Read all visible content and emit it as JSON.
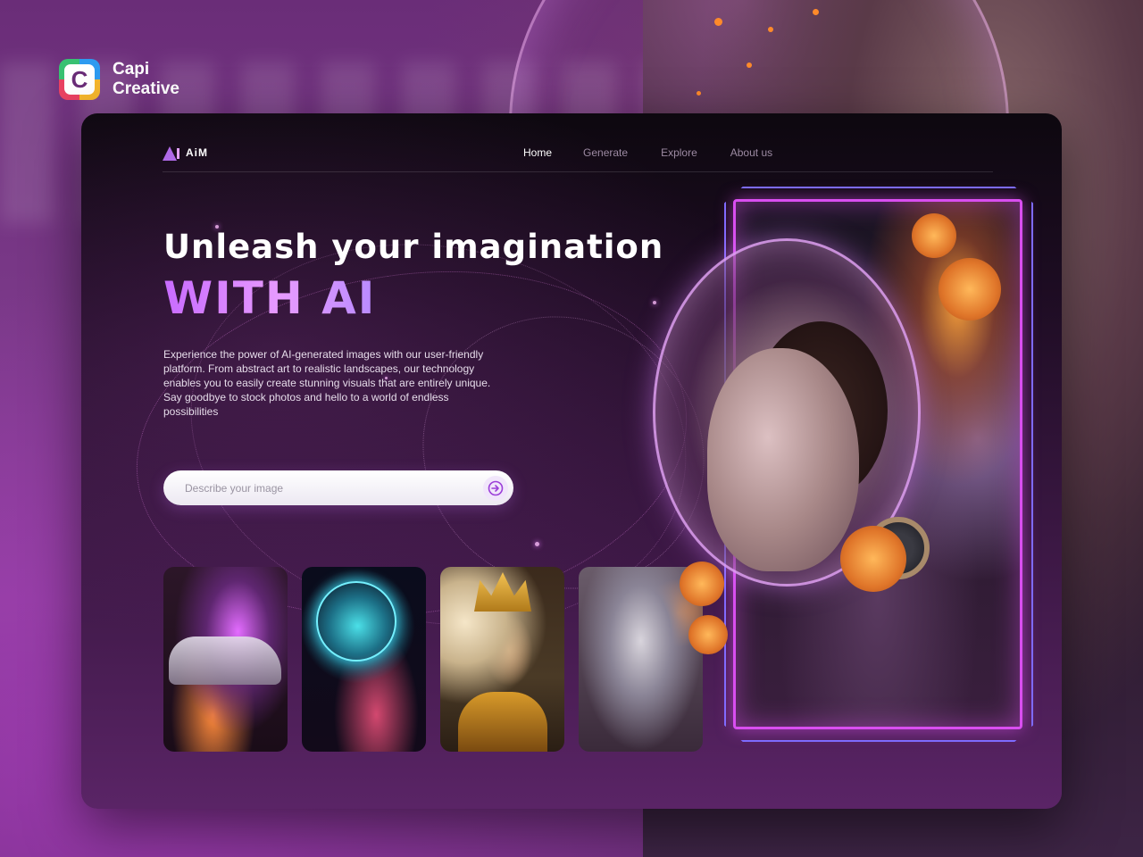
{
  "brand": {
    "name_line1": "Capi",
    "name_line2": "Creative",
    "logo_icon": "capi-logo-icon"
  },
  "nav": {
    "logo_text": "AiM",
    "links": [
      {
        "label": "Home",
        "active": true
      },
      {
        "label": "Generate",
        "active": false
      },
      {
        "label": "Explore",
        "active": false
      },
      {
        "label": "About us",
        "active": false
      }
    ]
  },
  "hero": {
    "title": "Unleash your imagination",
    "accent": "WITH AI",
    "description": "Experience the power of AI-generated images with our user-friendly platform. From abstract art to realistic landscapes, our technology enables you to easily create stunning visuals that are entirely unique. Say goodbye to stock photos and hello to a world of endless possibilities"
  },
  "search": {
    "placeholder": "Describe your image",
    "value": "",
    "submit_icon": "arrow-right-circle-icon"
  },
  "gallery": {
    "items": [
      {
        "subject": "neon sports car"
      },
      {
        "subject": "astronaut in glowing helmet"
      },
      {
        "subject": "golden armored warrior woman"
      },
      {
        "subject": "stone robot with flowers"
      }
    ]
  },
  "colors": {
    "accent": "#c86bff",
    "frame_outer": "#7a6dff",
    "frame_inner": "#d94ef0",
    "card_bg": "#1d0c22"
  }
}
